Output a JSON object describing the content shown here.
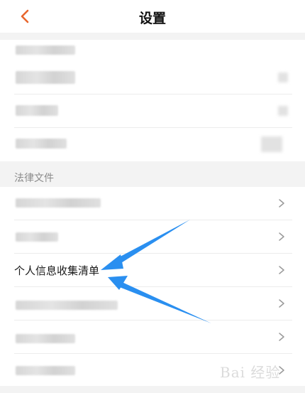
{
  "header": {
    "title": "设置",
    "back_icon": "chevron-left-icon",
    "accent": "#e8662e"
  },
  "legal": {
    "section_label": "法律文件",
    "highlight_item": "个人信息收集清单"
  },
  "colors": {
    "arrow": "#2a8ff0",
    "background": "#f3f3f3"
  },
  "watermark": {
    "text": "Bai 经验"
  }
}
